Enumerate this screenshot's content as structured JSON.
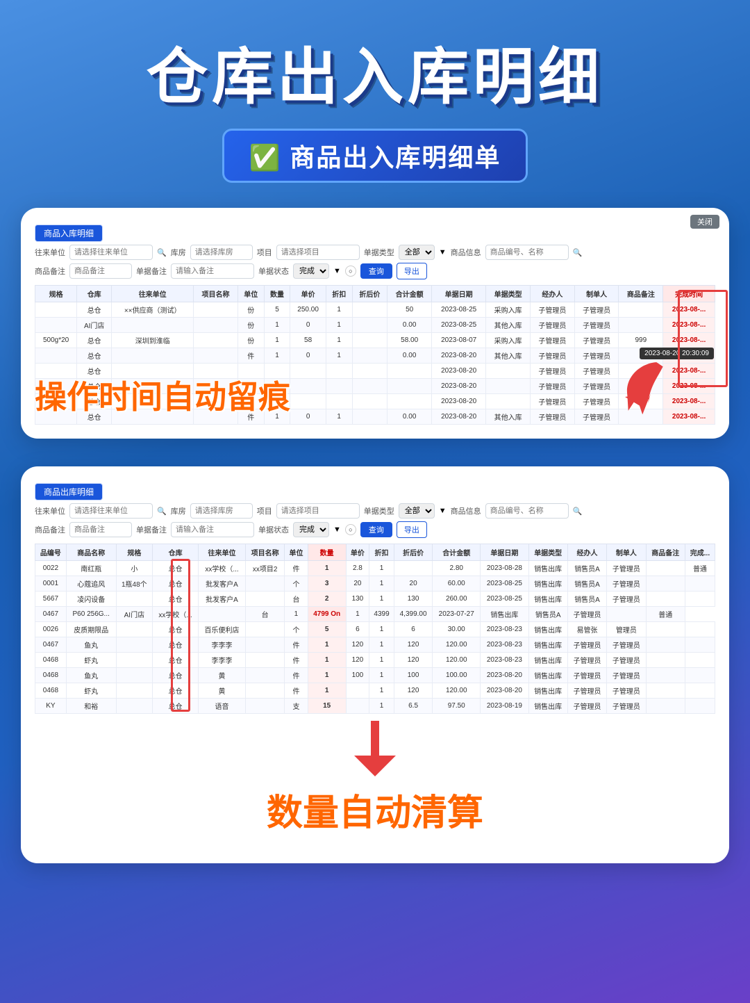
{
  "page": {
    "main_title": "仓库出入库明细",
    "subtitle": "✅ 商品出入库明细单",
    "card1": {
      "tab_label": "商品入库明细",
      "close_label": "关闭",
      "filters": {
        "from_unit_label": "往来单位",
        "from_unit_placeholder": "请选择往来单位",
        "warehouse_label": "库房",
        "warehouse_placeholder": "请选择库房",
        "item_label": "项目",
        "item_placeholder": "请选择项目",
        "order_type_label": "单据类型",
        "order_type_value": "全部",
        "goods_info_label": "商品信息",
        "goods_info_placeholder": "商品编号、名称"
      },
      "filter2": {
        "goods_note_label": "商品备注",
        "goods_note_placeholder": "商品备注",
        "order_note_label": "单据备注",
        "order_note_placeholder": "请输入备注",
        "order_status_label": "单据状态",
        "order_status_value": "完成",
        "query_btn": "查询",
        "export_btn": "导出"
      },
      "columns": [
        "规格",
        "仓库",
        "往来单位",
        "项目名称",
        "单位",
        "数量",
        "单价",
        "折扣",
        "折后价",
        "合计金额",
        "单据日期",
        "单据类型",
        "经办人",
        "制单人",
        "商品备注",
        "完成时间"
      ],
      "rows": [
        [
          "",
          "总仓",
          "××供应商（测试）",
          "",
          "份",
          "5",
          "250.00",
          "1",
          "",
          "50",
          "2023-08-25",
          "采购入库",
          "子管理员",
          "子管理员",
          "",
          "2023-08-..."
        ],
        [
          "",
          "AI门店",
          "",
          "",
          "份",
          "1",
          "0",
          "1",
          "",
          "0.00",
          "2023-08-25",
          "其他入库",
          "子管理员",
          "子管理员",
          "",
          "2023-08-..."
        ],
        [
          "500g*20",
          "总仓",
          "深圳到淮临",
          "",
          "份",
          "1",
          "58",
          "1",
          "",
          "58.00",
          "2023-08-07",
          "采购入库",
          "子管理员",
          "子管理员",
          "999",
          "2023-08-..."
        ],
        [
          "",
          "总仓",
          "",
          "",
          "件",
          "1",
          "0",
          "1",
          "",
          "0.00",
          "2023-08-20",
          "其他入库",
          "子管理员",
          "子管理员",
          "",
          "2023-08-..."
        ],
        [
          "",
          "总仓",
          "",
          "",
          "",
          "",
          "",
          "",
          "",
          "",
          "2023-08-20",
          "",
          "子管理员",
          "子管理员",
          "",
          "2023-08-..."
        ],
        [
          "",
          "总仓",
          "",
          "",
          "",
          "",
          "",
          "",
          "",
          "",
          "2023-08-20",
          "",
          "子管理员",
          "子管理员",
          "",
          "2023-08-..."
        ],
        [
          "",
          "总仓",
          "",
          "",
          "",
          "",
          "",
          "",
          "",
          "",
          "2023-08-20",
          "",
          "子管理员",
          "子管理员",
          "",
          "2023-08-..."
        ],
        [
          "",
          "总仓",
          "",
          "",
          "件",
          "1",
          "0",
          "1",
          "",
          "0.00",
          "2023-08-20",
          "其他入库",
          "子管理员",
          "子管理员",
          "",
          "2023-08-..."
        ]
      ],
      "overlay_text": "操作时间自动留痕",
      "tooltip_text": "2023-08-20 20:30:09"
    },
    "card2": {
      "tab_label": "商品出库明细",
      "filters": {
        "from_unit_label": "往来单位",
        "from_unit_placeholder": "请选择往来单位",
        "warehouse_label": "库房",
        "warehouse_placeholder": "请选择库房",
        "item_label": "项目",
        "item_placeholder": "请选择项目",
        "order_type_label": "单据类型",
        "order_type_value": "全部",
        "goods_info_label": "商品信息",
        "goods_info_placeholder": "商品编号、名称"
      },
      "filter2": {
        "goods_note_label": "商品备注",
        "goods_note_placeholder": "商品备注",
        "order_note_label": "单据备注",
        "order_note_placeholder": "请输入备注",
        "order_status_label": "单据状态",
        "order_status_value": "完成",
        "query_btn": "查询",
        "export_btn": "导出"
      },
      "columns": [
        "品编号",
        "商品名称",
        "规格",
        "仓库",
        "往来单位",
        "项目名称",
        "单位",
        "数量",
        "单价",
        "折扣",
        "折后价",
        "合计金额",
        "单据日期",
        "单据类型",
        "经办人",
        "制单人",
        "商品备注",
        "完成..."
      ],
      "rows": [
        [
          "0022",
          "南红瓶",
          "小",
          "总仓",
          "xx学校（...",
          "xx项目2",
          "件",
          "1",
          "2.8",
          "1",
          "",
          "2.80",
          "2023-08-28",
          "销售出库",
          "销售员A",
          "子管理员",
          "",
          "普通"
        ],
        [
          "0001",
          "心蔻追风",
          "1瓶48个",
          "总仓",
          "批发客户A",
          "",
          "个",
          "3",
          "20",
          "1",
          "20",
          "60.00",
          "2023-08-25",
          "销售出库",
          "销售员A",
          "子管理员",
          "",
          ""
        ],
        [
          "5667",
          "凌闪设备",
          "",
          "总仓",
          "批发客户A",
          "",
          "台",
          "2",
          "130",
          "1",
          "130",
          "260.00",
          "2023-08-25",
          "销售出库",
          "销售员A",
          "子管理员",
          "",
          ""
        ],
        [
          "0467",
          "P60 256G...",
          "AI门店",
          "xx学校（...",
          "",
          "台",
          "1",
          "4399",
          "1",
          "4399",
          "4,399.00",
          "2023-07-27",
          "销售出库",
          "销售员A",
          "子管理员",
          "",
          "普通"
        ],
        [
          "0026",
          "皮质期限品",
          "",
          "总仓",
          "百乐便利店",
          "",
          "个",
          "5",
          "6",
          "1",
          "6",
          "30.00",
          "2023-08-23",
          "销售出库",
          "易管张",
          "管理员",
          "",
          ""
        ],
        [
          "0467",
          "鱼丸",
          "",
          "总仓",
          "李李李",
          "",
          "件",
          "1",
          "120",
          "1",
          "120",
          "120.00",
          "2023-08-23",
          "销售出库",
          "子管理员",
          "子管理员",
          "",
          ""
        ],
        [
          "0468",
          "虾丸",
          "",
          "总仓",
          "李李李",
          "",
          "件",
          "1",
          "120",
          "1",
          "120",
          "120.00",
          "2023-08-23",
          "销售出库",
          "子管理员",
          "子管理员",
          "",
          ""
        ],
        [
          "0468",
          "鱼丸",
          "",
          "总仓",
          "黄",
          "",
          "件",
          "1",
          "100",
          "1",
          "100",
          "100.00",
          "2023-08-20",
          "销售出库",
          "子管理员",
          "子管理员",
          "",
          ""
        ],
        [
          "0468",
          "虾丸",
          "",
          "总仓",
          "黄",
          "",
          "件",
          "1",
          "",
          "1",
          "120",
          "120.00",
          "2023-08-20",
          "销售出库",
          "子管理员",
          "子管理员",
          "",
          ""
        ],
        [
          "KY",
          "和裕",
          "",
          "总仓",
          "语音",
          "",
          "支",
          "15",
          "",
          "1",
          "6.5",
          "97.50",
          "2023-08-19",
          "销售出库",
          "子管理员",
          "子管理员",
          "",
          ""
        ]
      ],
      "highlight_value": "4799 On",
      "overlay_text": "数量自动清算"
    }
  }
}
